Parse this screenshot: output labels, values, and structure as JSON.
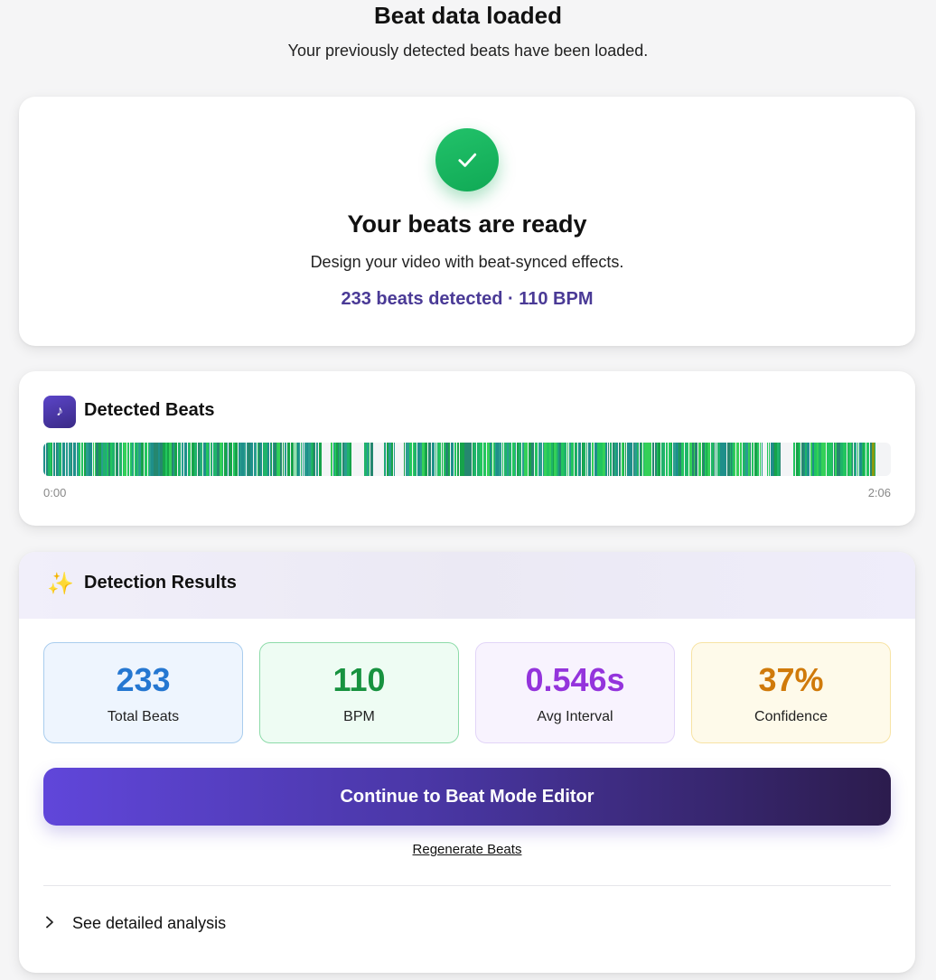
{
  "page": {
    "title": "Beat data loaded",
    "subtitle": "Your previously detected beats have been loaded."
  },
  "ready_card": {
    "icon": "checkmark-icon",
    "title": "Your beats are ready",
    "description": "Design your video with beat-synced effects.",
    "stats_line": "233 beats detected · 110 BPM"
  },
  "beats_card": {
    "icon": "music-note-icon",
    "icon_glyph": "♪",
    "title": "Detected Beats",
    "time_start": "0:00",
    "time_end": "2:06"
  },
  "results_card": {
    "icon": "sparkles-icon",
    "icon_glyph": "✨",
    "title": "Detection Results",
    "stats": [
      {
        "value": "233",
        "label": "Total Beats",
        "color": "#2577d1"
      },
      {
        "value": "110",
        "label": "BPM",
        "color": "#17923f"
      },
      {
        "value": "0.546s",
        "label": "Avg Interval",
        "color": "#9434dc"
      },
      {
        "value": "37%",
        "label": "Confidence",
        "color": "#d07a0a"
      }
    ],
    "continue_label": "Continue to Beat Mode Editor",
    "regenerate_label": "Regenerate Beats",
    "details_icon": "chevron-right-icon",
    "details_label": "See detailed analysis"
  },
  "colors": {
    "accent_purple": "#4a3a96",
    "beat_green": "#22c55e",
    "beat_teal": "#1e8f8a"
  }
}
